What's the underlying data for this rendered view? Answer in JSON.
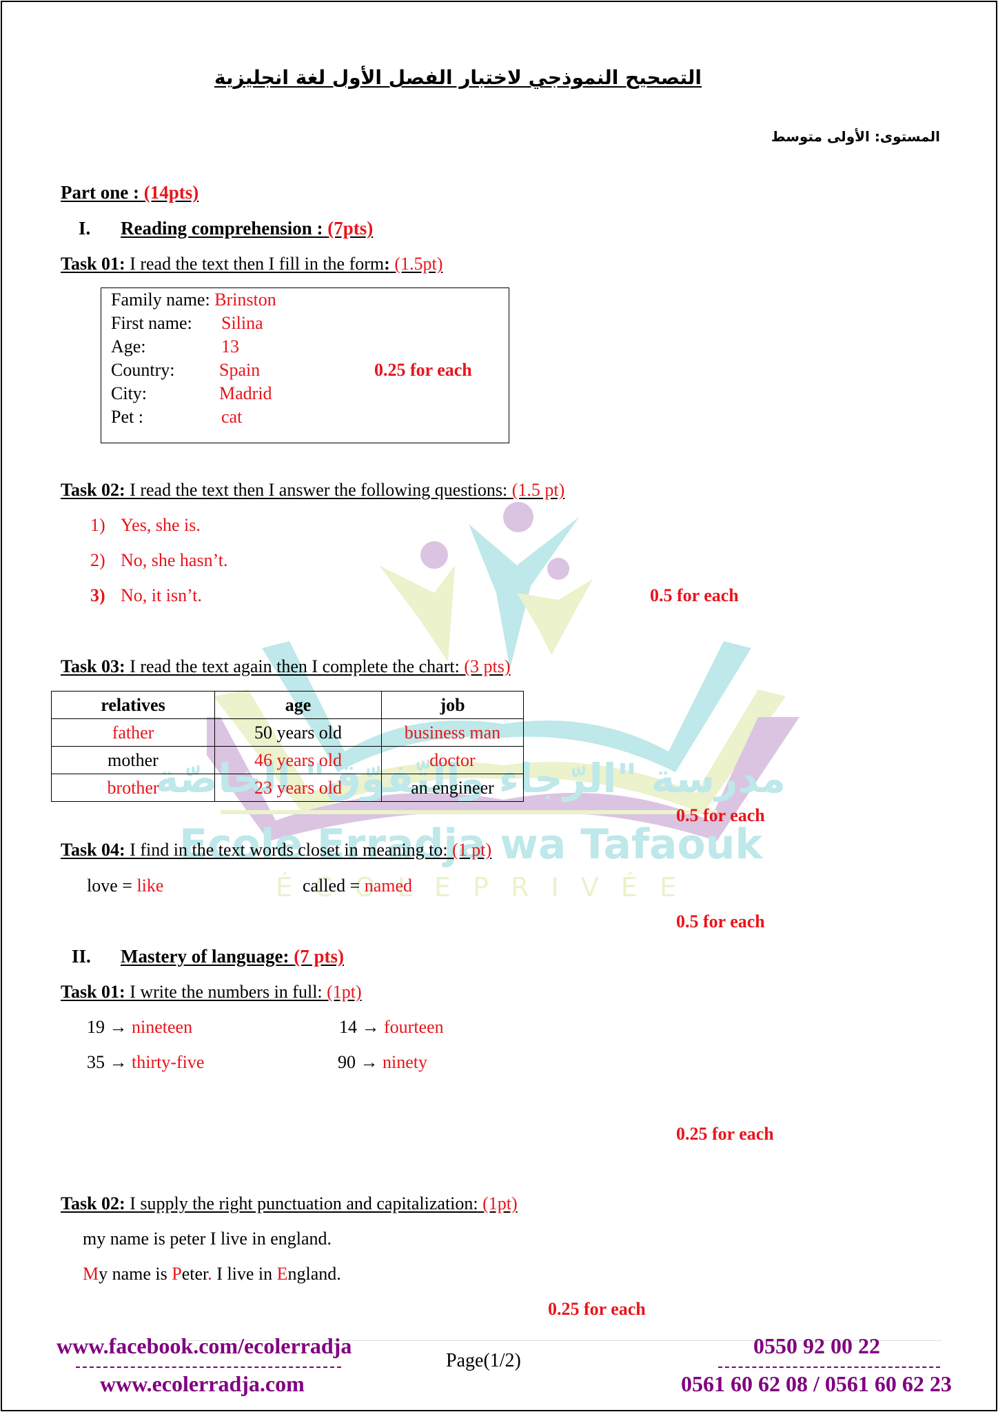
{
  "header": {
    "title_ar": "التصحيح النموذجي لاختبار الفصل الأول لغة انجليزية",
    "level_ar": "المستوى: الأولى متوسط"
  },
  "part_one": {
    "label": "Part one :",
    "points": "(14pts)"
  },
  "section_1": {
    "numeral": "I.",
    "label": "Reading comprehension :",
    "points": "(7pts)",
    "task1": {
      "label": "Task 01:",
      "text": " I read the text then I fill in the form",
      "colon": ":",
      "points": "(1.5pt)",
      "form": [
        {
          "label": "Family name:",
          "value": "Brinston"
        },
        {
          "label": "First name:",
          "value": "Silina"
        },
        {
          "label": "Age:",
          "value": "13"
        },
        {
          "label": "Country:",
          "value": "Spain"
        },
        {
          "label": "City:",
          "value": "Madrid"
        },
        {
          "label": "Pet :",
          "value": "cat"
        }
      ],
      "grading": "0.25 for each"
    },
    "task2": {
      "label": "Task 02:",
      "text": " I read the text then I answer the following questions:",
      "points": "(1.5 pt)",
      "answers": [
        {
          "num": "1)",
          "text": "Yes, she is."
        },
        {
          "num": "2)",
          "text": "No, she hasn’t."
        },
        {
          "num": "3)",
          "text": "No, it isn’t."
        }
      ],
      "grading": "0.5 for each"
    },
    "task3": {
      "label": "Task 03:",
      "text": " I read the text again then I complete the chart:",
      "points": "(3 pts)",
      "columns": [
        "relatives",
        "age",
        "job"
      ],
      "rows": [
        [
          {
            "text": "father",
            "answer": true
          },
          {
            "text": "50 years old",
            "answer": false
          },
          {
            "text": "business man",
            "answer": true
          }
        ],
        [
          {
            "text": "mother",
            "answer": false
          },
          {
            "text": "46 years old",
            "answer": true
          },
          {
            "text": "doctor",
            "answer": true
          }
        ],
        [
          {
            "text": "brother",
            "answer": true
          },
          {
            "text": "23 years old",
            "answer": true
          },
          {
            "text": "an engineer",
            "answer": false
          }
        ]
      ],
      "grading": "0.5 for each"
    },
    "task4": {
      "label": "Task 04:",
      "text": " I find in the text words closet in meaning to:",
      "points": "(1 pt)",
      "pairs": [
        {
          "word": "love = ",
          "answer": "like"
        },
        {
          "word": "called = ",
          "answer": "named"
        }
      ],
      "grading": "0.5 for each"
    }
  },
  "section_2": {
    "numeral": "II.",
    "label": "Mastery of language:",
    "points": "(7 pts)",
    "task1": {
      "label": "Task 01:",
      "text": " I write the numbers in full:",
      "points": "(1pt)",
      "items": [
        {
          "num": "19 → ",
          "answer": "nineteen"
        },
        {
          "num": "14 → ",
          "answer": "fourteen"
        },
        {
          "num": "35 → ",
          "answer": "thirty-five"
        },
        {
          "num": "90 → ",
          "answer": "ninety"
        }
      ],
      "grading": "0.25 for each"
    },
    "task2": {
      "label": "Task 02:",
      "text": " I supply the right punctuation and capitalization:",
      "points": "(1pt)",
      "original": "my name is peter I live in england.",
      "corrected": [
        {
          "t": "M",
          "red": true
        },
        {
          "t": "y name is ",
          "red": false
        },
        {
          "t": "P",
          "red": true
        },
        {
          "t": "eter",
          "red": false
        },
        {
          "t": ".",
          "red": true
        },
        {
          "t": " I live in ",
          "red": false
        },
        {
          "t": "E",
          "red": true
        },
        {
          "t": "ngland.",
          "red": false
        }
      ],
      "grading": "0.25 for each"
    }
  },
  "watermark": {
    "name_ar": "مدرسة \"الرّجاء والتّفوّق\" الخاصّة",
    "name_latin": "Ecole Erradja wa Tafaouk",
    "subtitle": "É C O L E   P R I V É E"
  },
  "footer": {
    "facebook": "www.facebook.com/ecolerradja",
    "website": "www.ecolerradja.com",
    "page": "Page",
    "page_num": "(1/2)",
    "phone1": "0550 92 00 22",
    "phone2": "0561 60 62 08 / 0561 60 62 23"
  },
  "colors": {
    "answer_red": "#e8141b",
    "footer_purple": "#800080",
    "watermark_teal": "#7fd3d4",
    "watermark_lilac": "#b98ac7",
    "watermark_lime": "#d9e79a"
  }
}
